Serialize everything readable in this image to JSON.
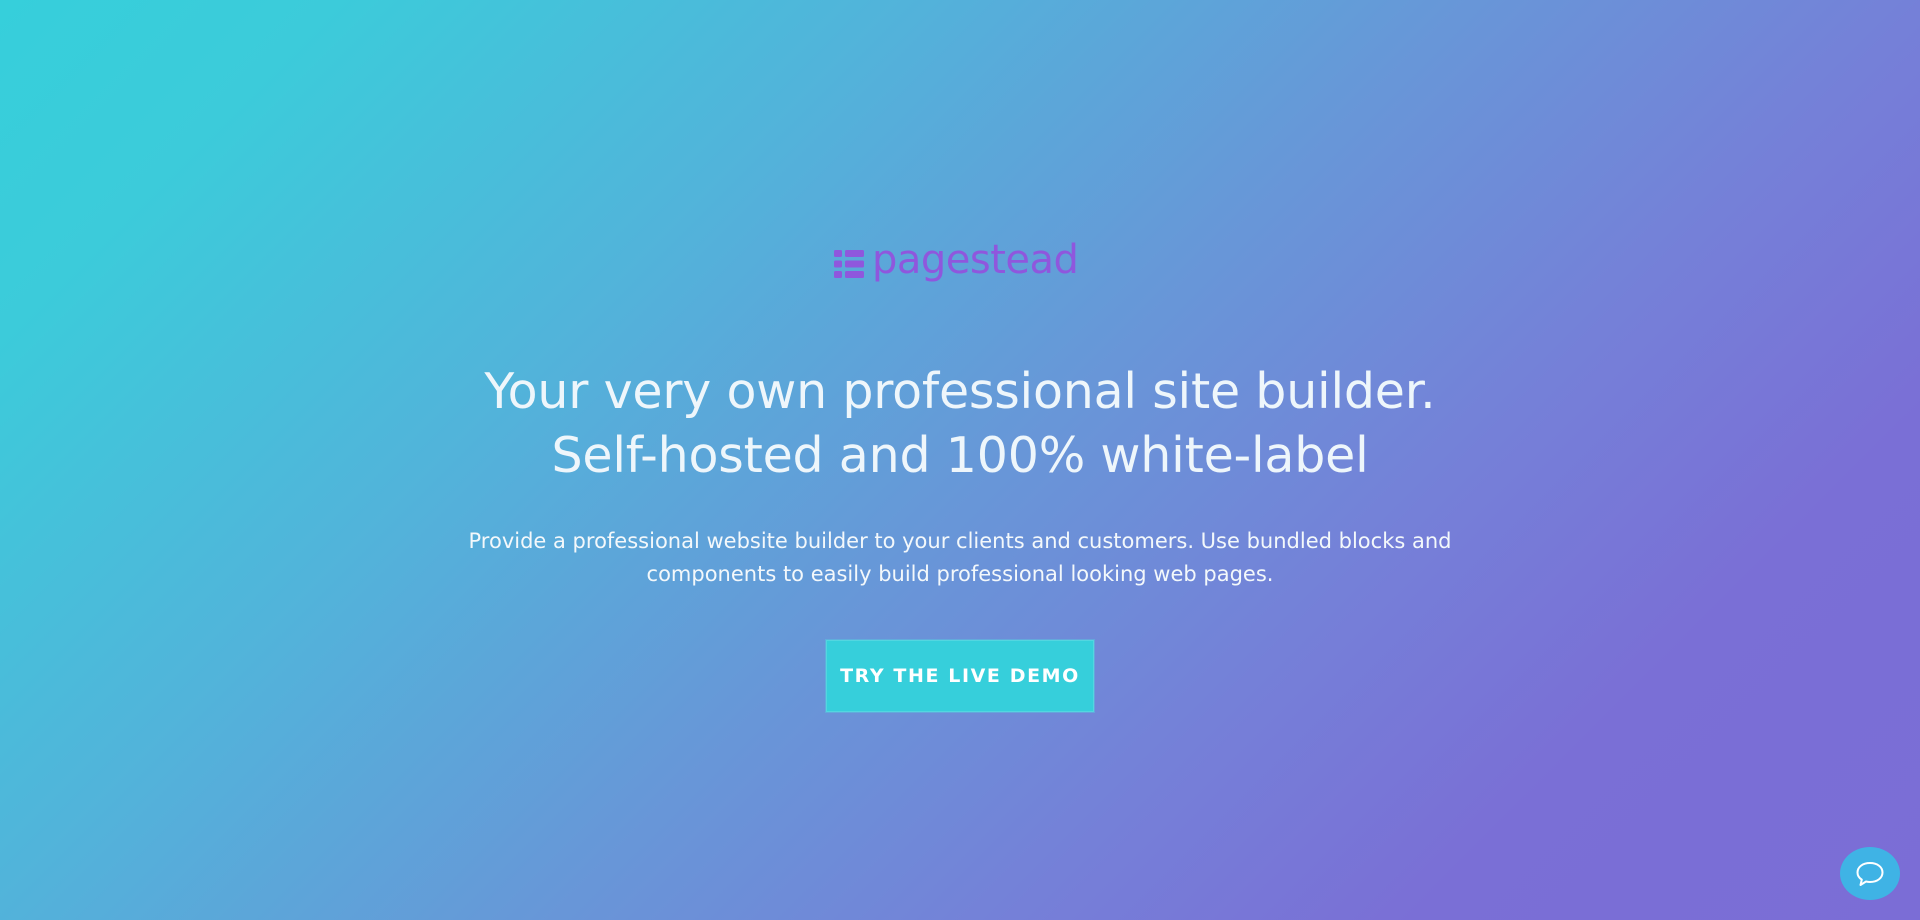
{
  "brand": {
    "name": "pagestead",
    "logo_icon": "grid-blocks-icon",
    "color": "#8f57dd"
  },
  "hero": {
    "headline_line1": "Your very own professional site builder.",
    "headline_line2": "Self-hosted and 100% white-label",
    "subtext_line1": "Provide a professional website builder to your clients and customers. Use bundled blocks and",
    "subtext_line2": "components to easily build professional looking web pages.",
    "cta_label": "TRY THE LIVE DEMO",
    "accent_color": "#36cfdb",
    "gradient_start": "#36cfdb",
    "gradient_end": "#7b6dd6"
  },
  "chat_widget": {
    "icon": "chat-bubble-icon",
    "color": "#3fb3e5"
  }
}
